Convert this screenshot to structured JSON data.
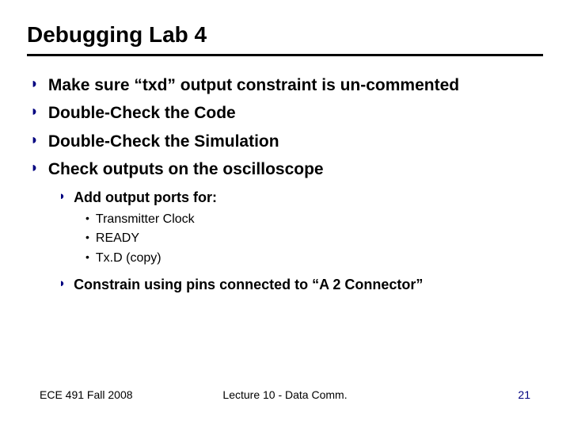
{
  "title": "Debugging Lab 4",
  "bullets": [
    "Make sure “txd” output constraint is un-commented",
    "Double-Check the Code",
    "Double-Check the Simulation",
    "Check outputs on the oscilloscope"
  ],
  "sub": {
    "first": "Add output ports for:",
    "items": [
      "Transmitter Clock",
      "READY",
      "Tx.D (copy)"
    ],
    "last": "Constrain using pins connected to “A 2 Connector”"
  },
  "footer": {
    "left": "ECE 491 Fall 2008",
    "center": "Lecture 10 - Data Comm.",
    "right": "21"
  }
}
